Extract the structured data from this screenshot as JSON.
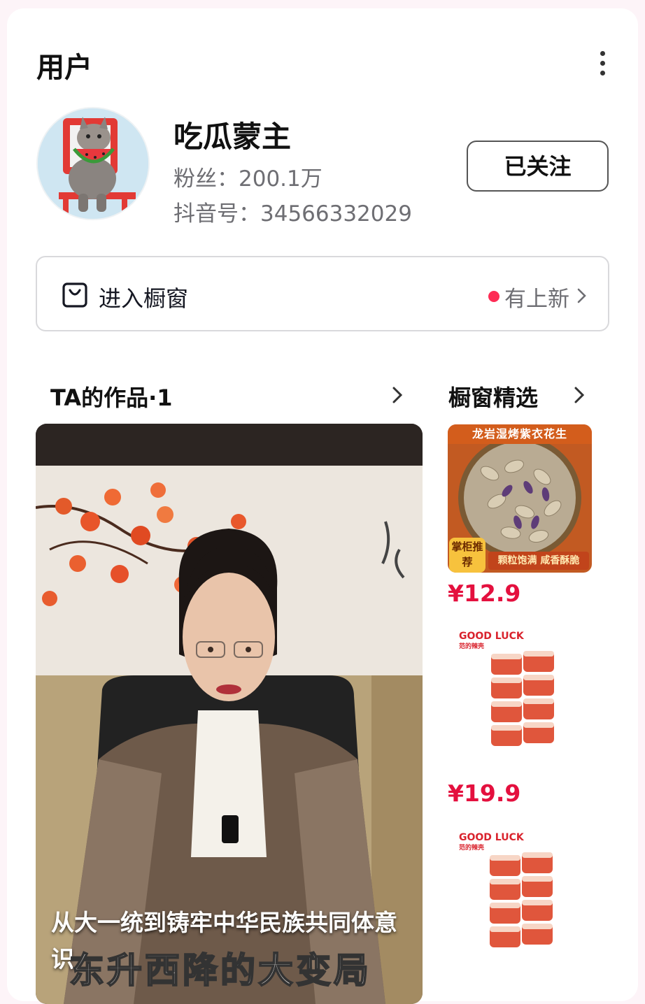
{
  "header": {
    "title": "用户"
  },
  "profile": {
    "name": "吃瓜蒙主",
    "fans_label": "粉丝：",
    "fans_value": "200.1万",
    "douyin_label": "抖音号：",
    "douyin_id": "34566332029",
    "follow_button": "已关注"
  },
  "shop": {
    "label": "进入橱窗",
    "status": "有上新"
  },
  "works": {
    "title": "TA的作品·1"
  },
  "picks": {
    "title": "橱窗精选"
  },
  "video": {
    "caption": "从大一统到铸牢中华民族共同体意识",
    "overlay_text": "东升西降的大变局"
  },
  "products": [
    {
      "price": "¥12.9",
      "image_text_top": "龙岩湿烤紫衣花生",
      "image_badge": "掌柜推荐",
      "image_banner": "颗粒饱满 咸香酥脆"
    },
    {
      "price": "¥19.9",
      "brand": "GOOD LUCK",
      "brand_sub": "范的辣壳"
    },
    {
      "brand": "GOOD LUCK",
      "brand_sub": "范的辣壳"
    }
  ],
  "colors": {
    "accent": "#fe2c55",
    "price": "#e4103e"
  }
}
